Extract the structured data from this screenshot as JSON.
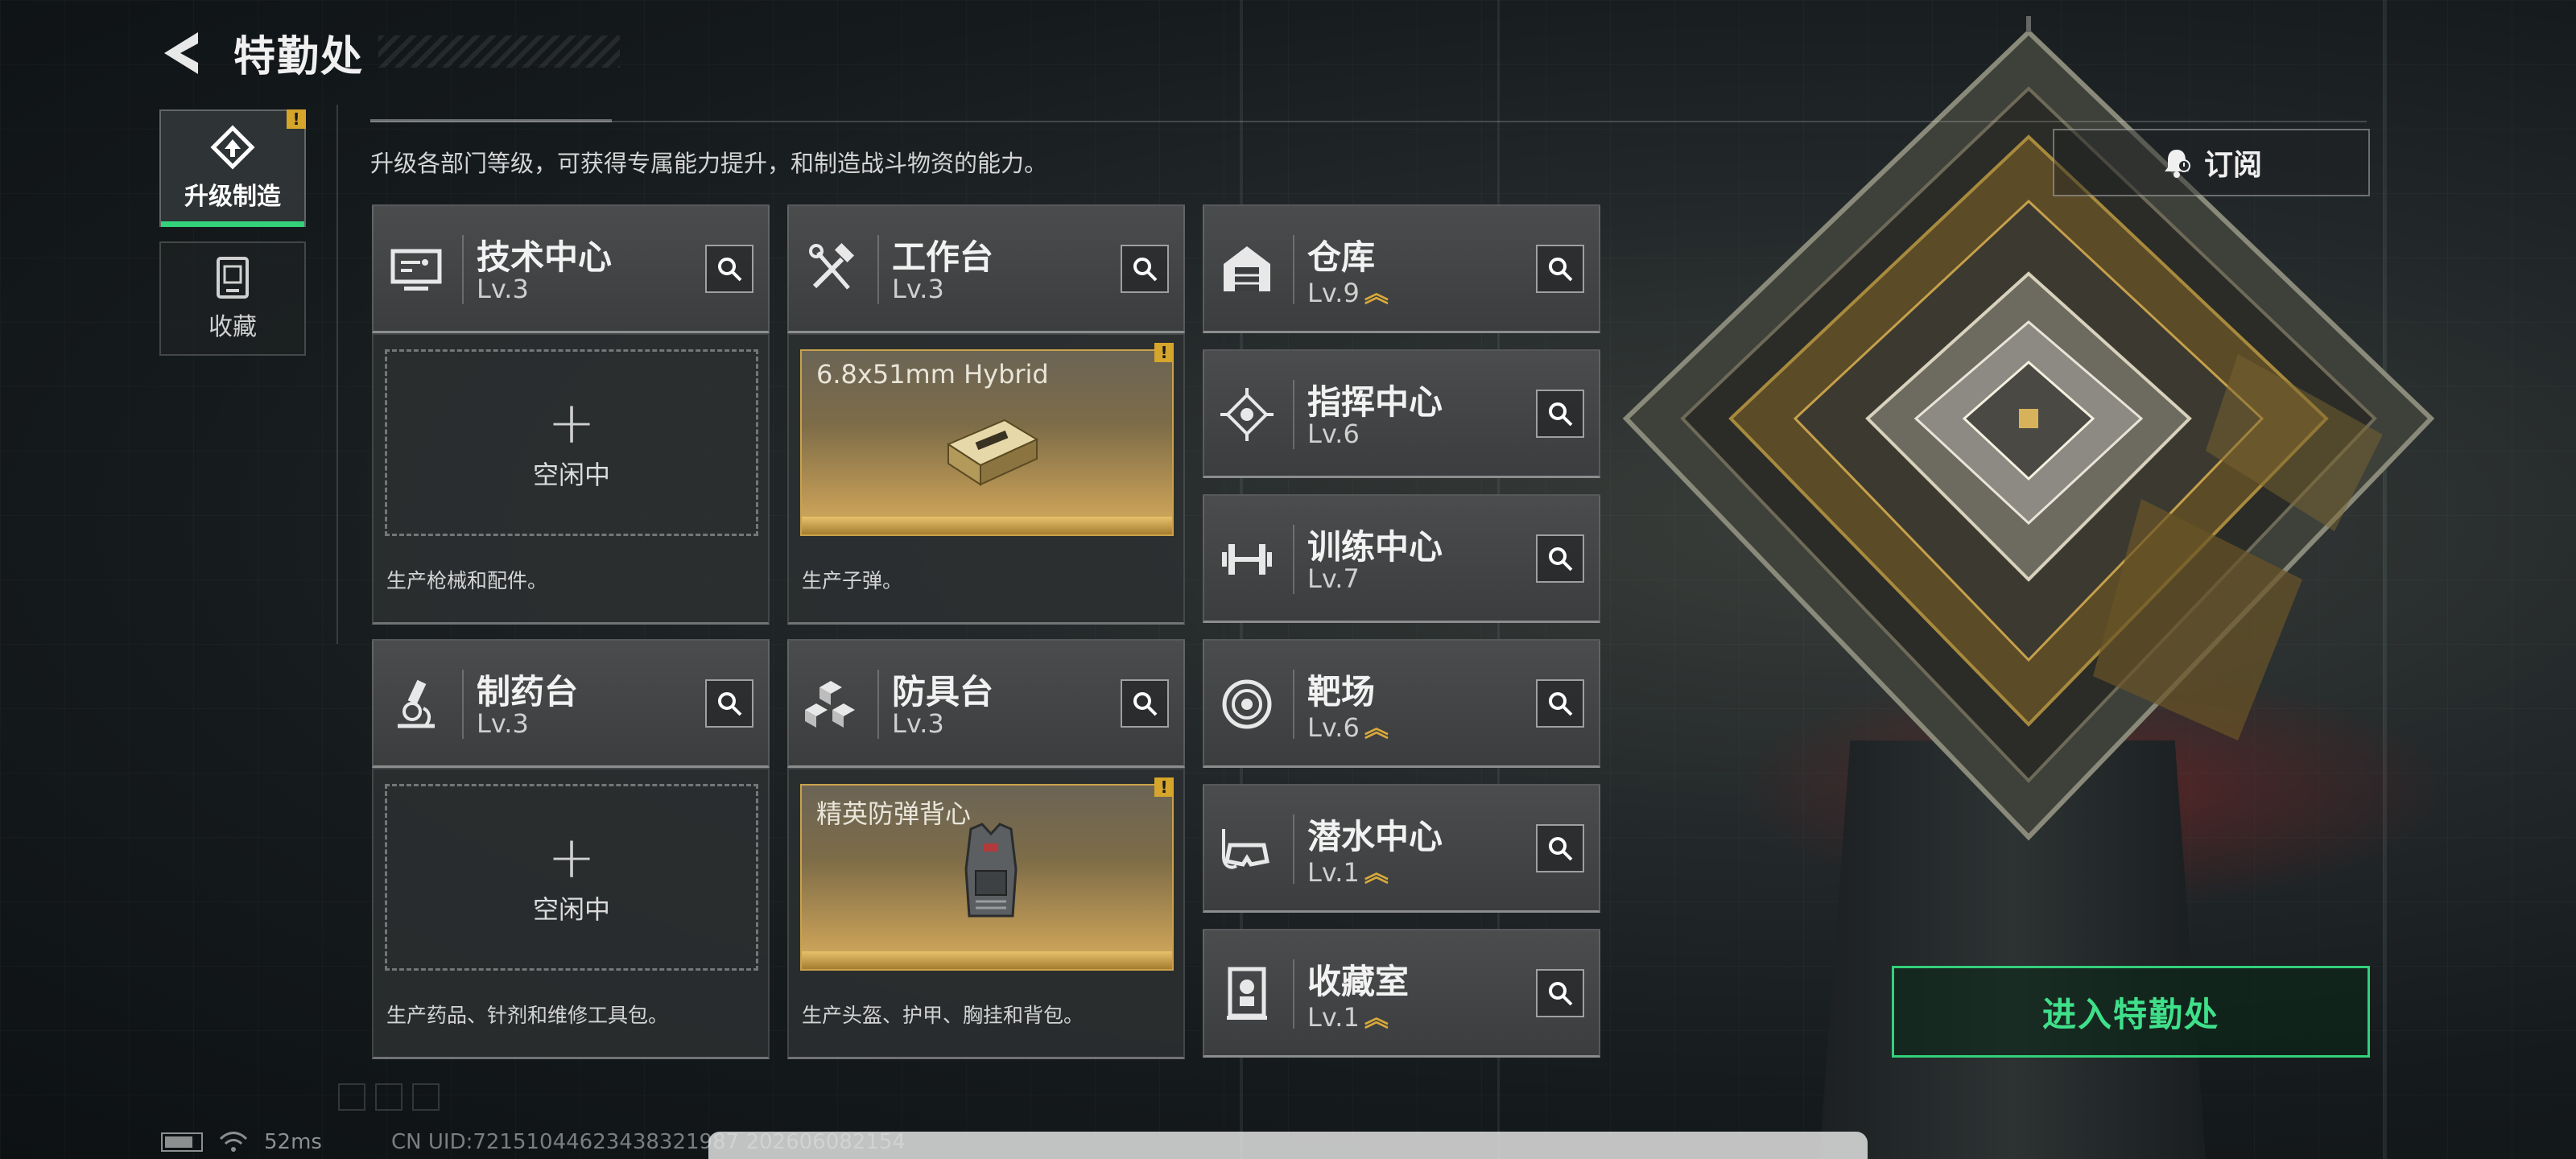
{
  "header": {
    "title": "特勤处",
    "subtitle": "升级各部门等级，可获得专属能力提升，和制造战斗物资的能力。"
  },
  "tabs": [
    {
      "label": "升级制造",
      "active": true,
      "has_alert": true
    },
    {
      "label": "收藏",
      "active": false,
      "has_alert": false
    }
  ],
  "alert_mark": "!",
  "departments": {
    "tech": {
      "name": "技术中心",
      "level": "Lv.3"
    },
    "workbench": {
      "name": "工作台",
      "level": "Lv.3"
    },
    "pharmacy": {
      "name": "制药台",
      "level": "Lv.3"
    },
    "armor": {
      "name": "防具台",
      "level": "Lv.3"
    },
    "warehouse": {
      "name": "仓库",
      "level": "Lv.9",
      "upgradable": true
    },
    "command": {
      "name": "指挥中心",
      "level": "Lv.6",
      "upgradable": false
    },
    "training": {
      "name": "训练中心",
      "level": "Lv.7",
      "upgradable": false
    },
    "range": {
      "name": "靶场",
      "level": "Lv.6",
      "upgradable": true
    },
    "diving": {
      "name": "潜水中心",
      "level": "Lv.1",
      "upgradable": true
    },
    "collection": {
      "name": "收藏室",
      "level": "Lv.1",
      "upgradable": true
    }
  },
  "production": {
    "tech": {
      "status": "idle",
      "plus": "+",
      "idle_label": "空闲中",
      "desc": "生产枪械和配件。"
    },
    "workbench": {
      "status": "producing",
      "item": "6.8x51mm Hybrid",
      "desc": "生产子弹。"
    },
    "pharmacy": {
      "status": "idle",
      "plus": "+",
      "idle_label": "空闲中",
      "desc": "生产药品、针剂和维修工具包。"
    },
    "armor": {
      "status": "producing",
      "item": "精英防弹背心",
      "desc": "生产头盔、护甲、胸挂和背包。"
    }
  },
  "subscribe_label": "订阅",
  "enter_label": "进入特勤处",
  "status_bar": {
    "ping": "52ms",
    "uid": "CN UID:72151044623438321987 202606082154"
  },
  "colors": {
    "accent_green": "#33d17a",
    "alert_yellow": "#d6a52b",
    "upgrade_gold": "#d9a93a"
  }
}
